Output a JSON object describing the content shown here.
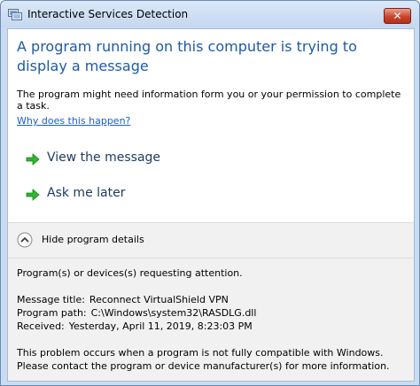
{
  "window": {
    "title": "Interactive Services Detection",
    "close_glyph": "✕"
  },
  "headline": "A program running on this computer is trying to display a message",
  "description": "The program might need information form you or your permission to complete a task.",
  "why_link": "Why does this happen?",
  "commands": [
    {
      "label": "View the message",
      "icon": "green-arrow-icon"
    },
    {
      "label": "Ask me later",
      "icon": "green-arrow-icon"
    }
  ],
  "details": {
    "toggle_label": "Hide program details",
    "toggle_icon": "chevron-up-icon",
    "attention": "Program(s) or devices(s) requesting attention.",
    "message_title_label": "Message title:",
    "message_title_value": "Reconnect VirtualShield VPN",
    "program_path_label": "Program path:",
    "program_path_value": "C:\\Windows\\system32\\RASDLG.dll",
    "received_label": "Received:",
    "received_value": "Yesterday, April 11, 2019, 8:23:03 PM",
    "problem_line1": "This problem occurs when a program is not fully compatible with Windows.",
    "problem_line2": "Please contact the program or device manufacturer(s) for more information."
  },
  "colors": {
    "headline": "#1d5aa8",
    "link": "#1a5fc7",
    "command": "#1e3b61",
    "arrow": "#2db82d"
  }
}
